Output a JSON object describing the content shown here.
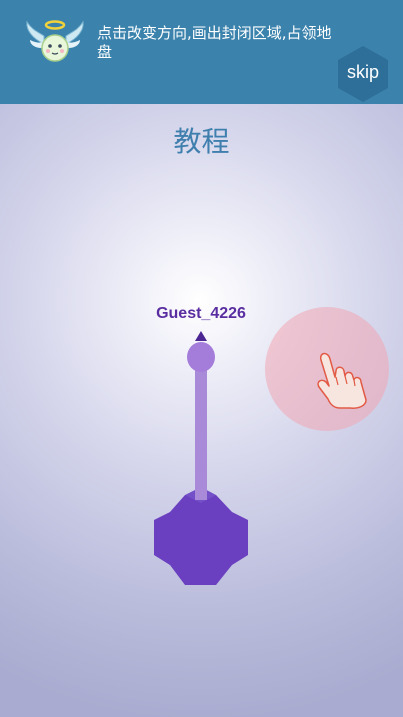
{
  "banner": {
    "text": "点击改变方向,画出封闭区域,占领地盘",
    "skip_label": "skip"
  },
  "tutorial": {
    "title": "教程"
  },
  "player": {
    "name": "Guest_4226",
    "color": "#6a3fc0",
    "trail_color": "#a88ad8"
  },
  "colors": {
    "banner_bg": "#3b83ac",
    "skip_bg": "#2e6f99",
    "title": "#3f7fae",
    "touch_circle": "#f0a6b3"
  },
  "icons": {
    "mascot": "angel-mascot-icon",
    "hand": "pointing-hand-icon",
    "direction": "up-arrow-icon"
  }
}
